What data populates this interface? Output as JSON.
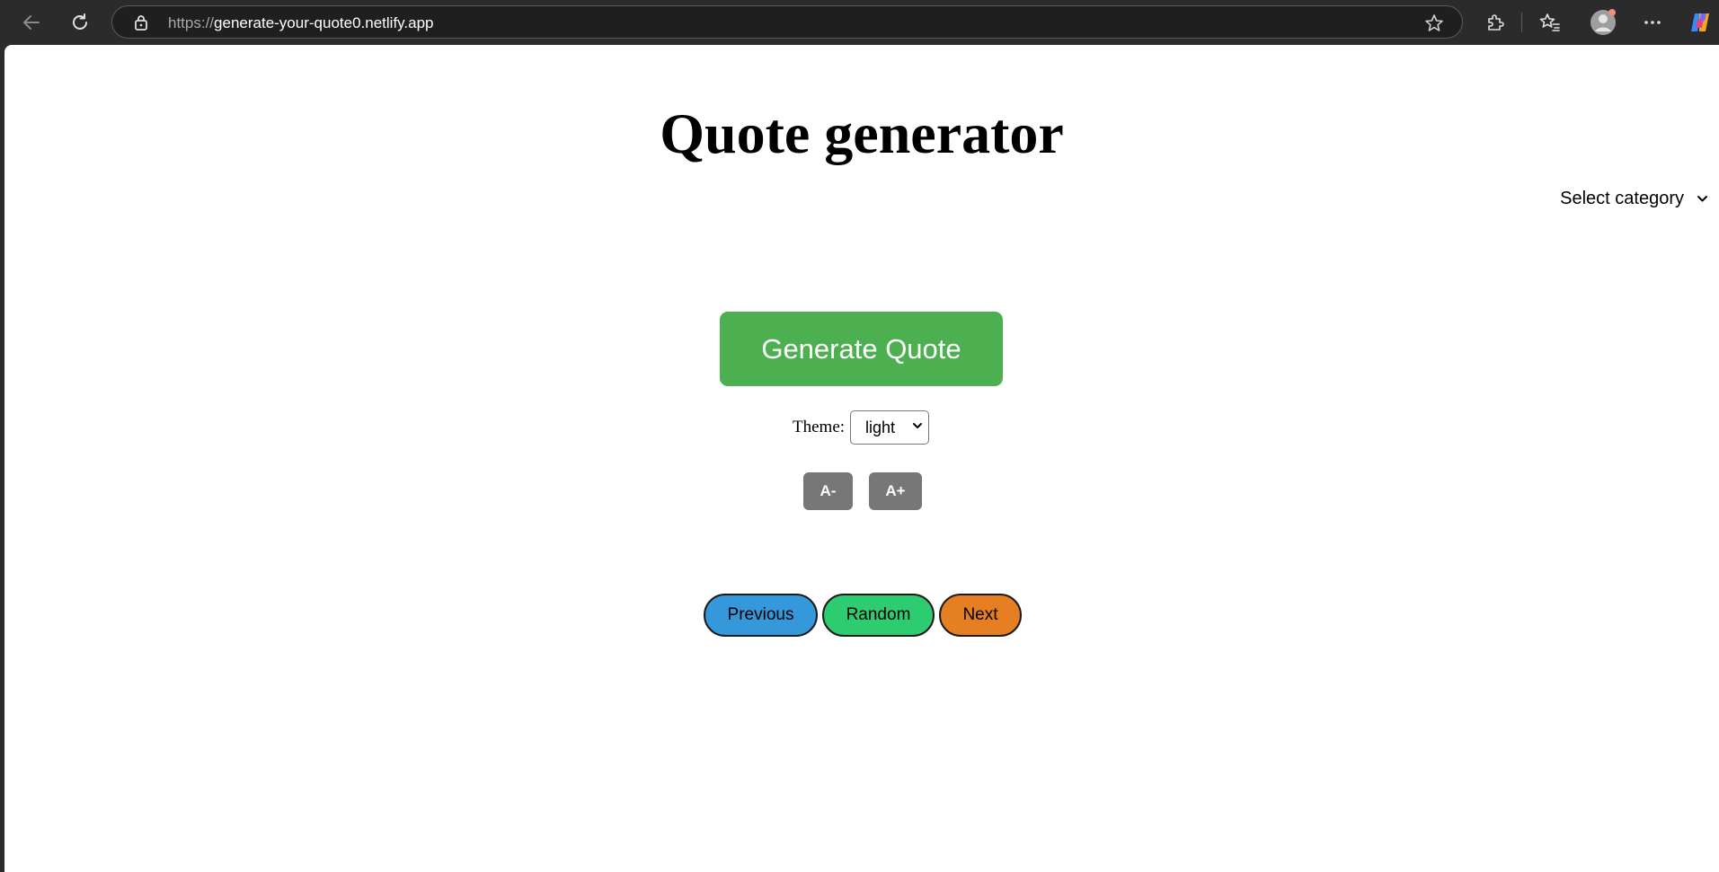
{
  "browser": {
    "url_scheme": "https://",
    "url_host": "generate-your-quote0.netlify.app",
    "icons": [
      "back-icon",
      "refresh-icon",
      "lock-icon",
      "star-icon",
      "extensions-icon",
      "favorites-icon",
      "profile-icon",
      "more-icon",
      "copilot-icon"
    ]
  },
  "page": {
    "title": "Quote generator",
    "category_select": {
      "value": "Select category"
    },
    "generate_button": "Generate Quote",
    "theme": {
      "label": "Theme:",
      "value": "light"
    },
    "font_controls": {
      "decrease": "A-",
      "increase": "A+"
    },
    "nav": {
      "previous": "Previous",
      "random": "Random",
      "next": "Next"
    }
  },
  "colors": {
    "generate": "#4caf50",
    "font_buttons": "#777777",
    "previous": "#3498db",
    "random": "#2ecc71",
    "next": "#e67e22"
  }
}
